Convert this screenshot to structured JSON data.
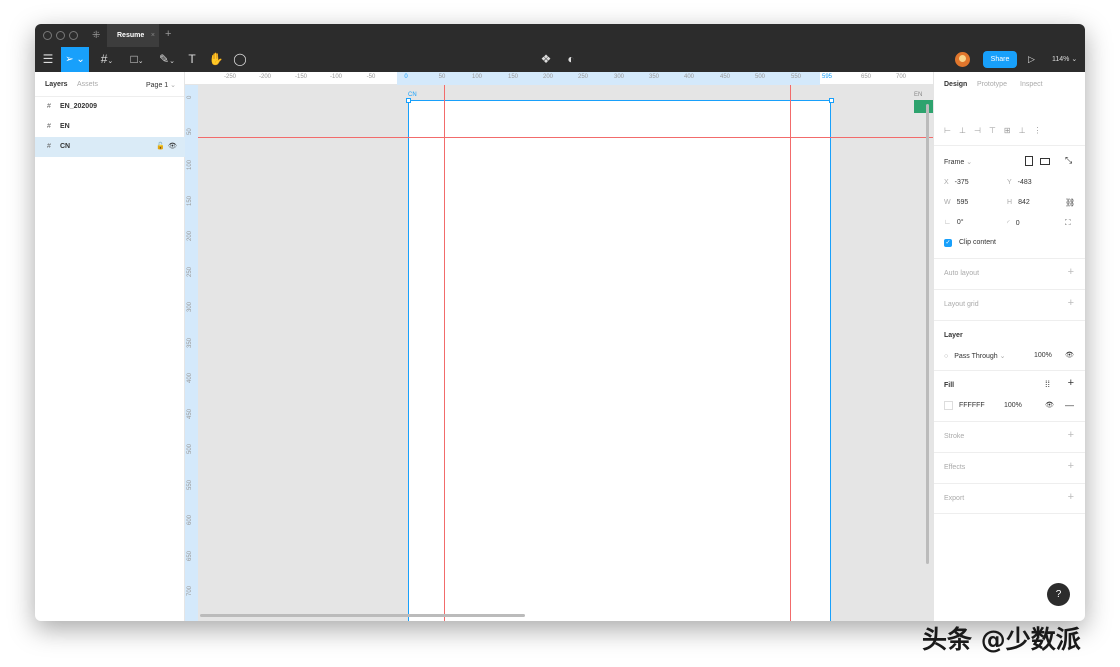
{
  "window": {
    "tab_title": "Resume",
    "tab_close": "×",
    "new_tab": "+"
  },
  "toolbar": {
    "share_label": "Share",
    "zoom": "114%",
    "zoom_caret": "⌄"
  },
  "left_panel": {
    "tabs": [
      "Layers",
      "Assets"
    ],
    "page": "Page 1",
    "layers": [
      {
        "name": "EN_202009"
      },
      {
        "name": "EN"
      },
      {
        "name": "CN",
        "selected": true
      }
    ]
  },
  "rulers": {
    "top": [
      "-250",
      "-200",
      "-150",
      "-100",
      "-50",
      "0",
      "50",
      "100",
      "150",
      "200",
      "250",
      "300",
      "350",
      "400",
      "450",
      "500",
      "550",
      "595",
      "650",
      "700"
    ],
    "left": [
      "0",
      "50",
      "100",
      "150",
      "200",
      "250",
      "300",
      "350",
      "400",
      "450",
      "500",
      "550",
      "600",
      "650",
      "700"
    ]
  },
  "canvas": {
    "frame_label": "CN",
    "other_frame_label": "EN"
  },
  "right_panel": {
    "tabs": [
      "Design",
      "Prototype",
      "Inspect"
    ],
    "frame_label": "Frame",
    "x_label": "X",
    "x": "-375",
    "y_label": "Y",
    "y": "-483",
    "w_label": "W",
    "w": "595",
    "h_label": "H",
    "h": "842",
    "rotation": "0°",
    "radius": "0",
    "clip_content": "Clip content",
    "auto_layout": "Auto layout",
    "layout_grid": "Layout grid",
    "layer_title": "Layer",
    "blend_mode": "Pass Through",
    "opacity": "100%",
    "fill_title": "Fill",
    "fill_hex": "FFFFFF",
    "fill_opacity": "100%",
    "stroke": "Stroke",
    "effects": "Effects",
    "export": "Export"
  },
  "help": "?",
  "watermark": "头条 @少数派",
  "colors": {
    "accent": "#18a0fb",
    "guide": "#f26b6b",
    "dark": "#2c2c2c"
  }
}
